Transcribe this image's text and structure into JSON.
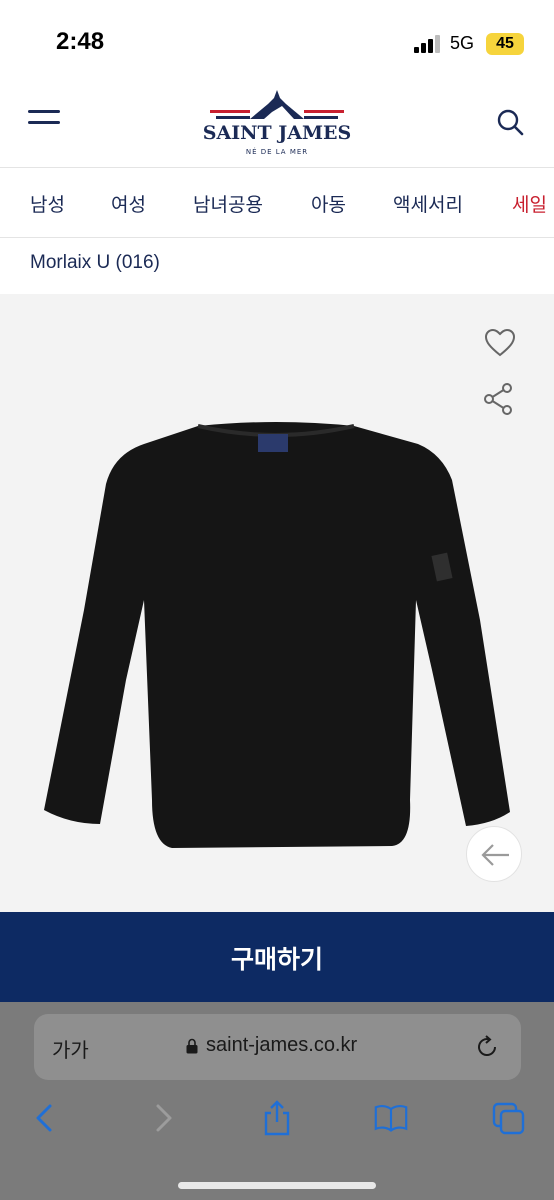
{
  "status_bar": {
    "time": "2:48",
    "network": "5G",
    "battery": "45"
  },
  "header": {
    "brand": "SAINT JAMES",
    "tagline": "NÉ DE LA MER",
    "icons": {
      "menu": "menu-icon",
      "search": "search-icon"
    }
  },
  "nav": {
    "items": [
      {
        "label": "남성"
      },
      {
        "label": "여성"
      },
      {
        "label": "남녀공용"
      },
      {
        "label": "아동"
      },
      {
        "label": "액세서리"
      },
      {
        "label": "세일"
      }
    ]
  },
  "breadcrumb": "Morlaix U (016)",
  "product": {
    "icons": {
      "wishlist": "heart-icon",
      "share": "share-icon",
      "prev": "arrow-left-icon"
    },
    "image": "black long-sleeve boat neck shirt"
  },
  "buy_button": {
    "label": "구매하기"
  },
  "browser": {
    "text_size": "가가",
    "url": "saint-james.co.kr",
    "toolbar": [
      "back-icon",
      "forward-icon",
      "share-icon",
      "bookmarks-icon",
      "tabs-icon"
    ]
  },
  "colors": {
    "brand_navy": "#0d2a63",
    "sale_red": "#c8202f",
    "product_bg": "#f3f3f3"
  }
}
